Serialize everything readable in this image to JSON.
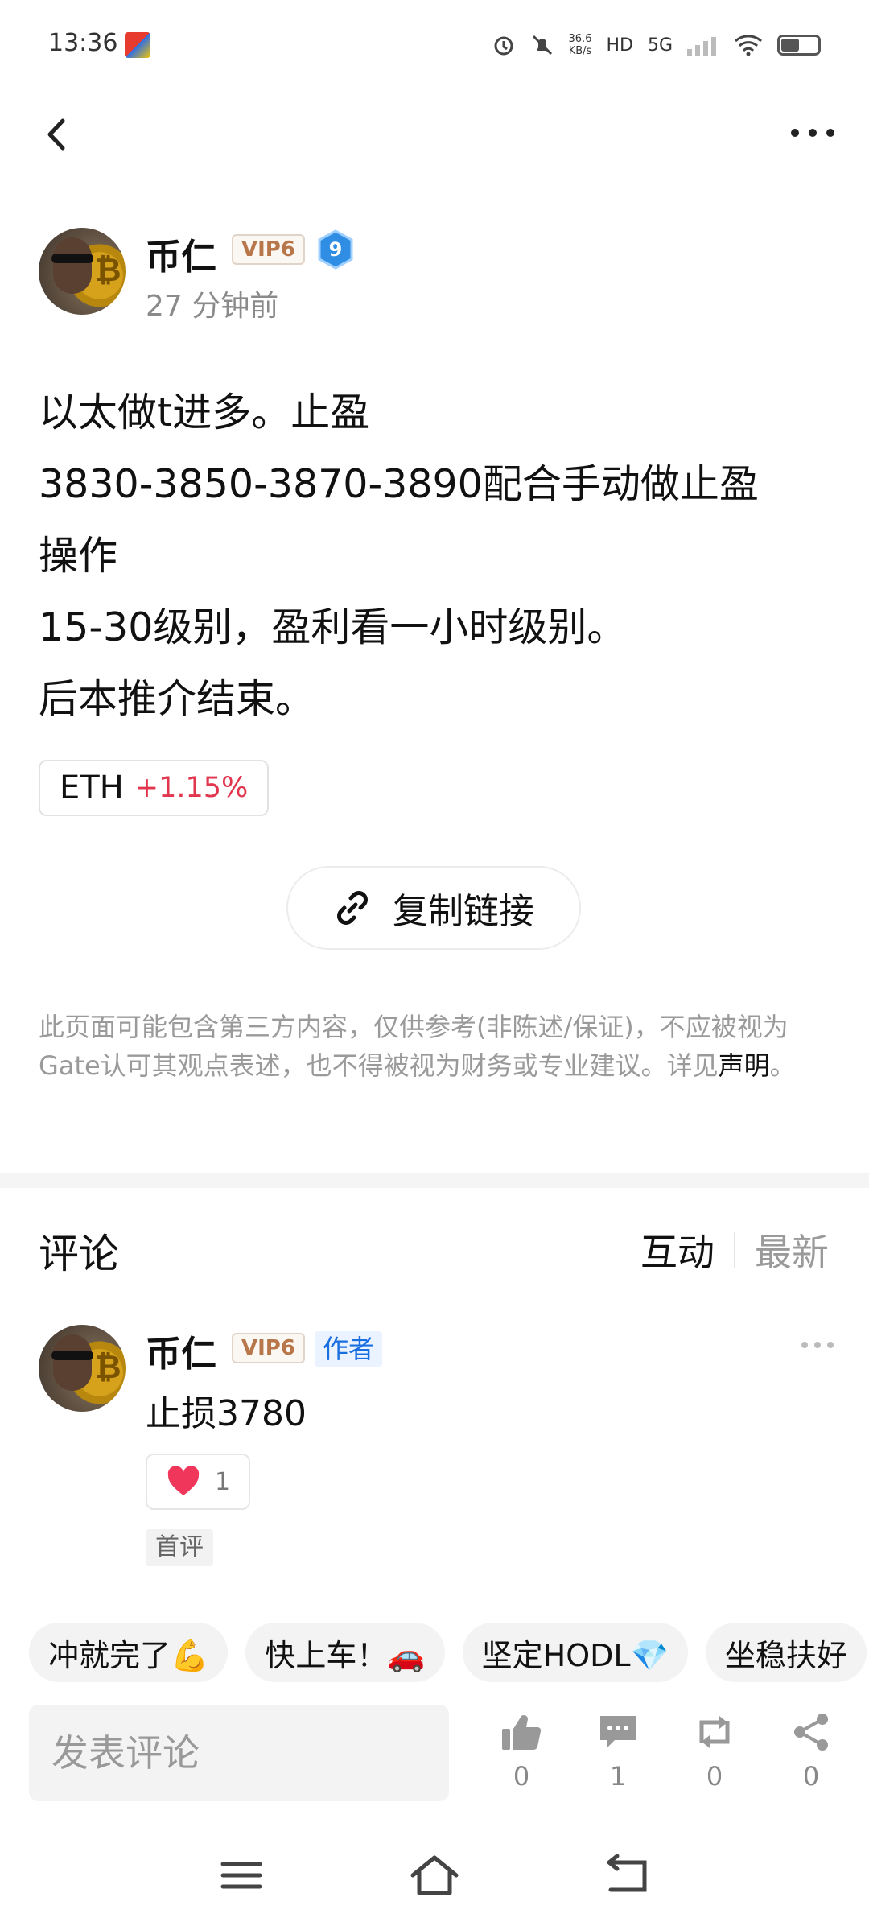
{
  "status_bar": {
    "time": "13:36",
    "net_speed_value": "36.6",
    "net_speed_unit": "KB/s",
    "hd_label": "HD",
    "network_label": "5G"
  },
  "post": {
    "author": {
      "name": "币仁",
      "vip": "VIP6",
      "level": "9",
      "time_ago": "27 分钟前"
    },
    "lines": [
      "以太做t进多。止盈",
      "3830-3850-3870-3890配合手动做止盈",
      "操作",
      "15-30级别，盈利看一小时级别。",
      "后本推介结束。"
    ],
    "tag": {
      "symbol": "ETH",
      "change": "+1.15%"
    },
    "copy_link_label": "复制链接",
    "disclaimer": "此页面可能包含第三方内容，仅供参考(非陈述/保证)，不应被视为Gate认可其观点表述，也不得被视为财务或专业建议。详见",
    "disclaimer_link": "声明",
    "disclaimer_end": "。"
  },
  "comments": {
    "title": "评论",
    "sort_interactive": "互动",
    "sort_latest": "最新",
    "items": [
      {
        "name": "币仁",
        "vip": "VIP6",
        "author_badge": "作者",
        "text": "止损3780",
        "likes": "1",
        "badge": "首评"
      }
    ]
  },
  "quick_replies": [
    "冲就完了💪",
    "快上车！🚗",
    "坚定HODL💎",
    "坐稳扶好"
  ],
  "bottom_bar": {
    "comment_placeholder": "发表评论",
    "like_count": "0",
    "comment_count": "1",
    "repost_count": "0",
    "share_count": "0"
  },
  "colors": {
    "positive_change": "#e2364f",
    "vip_text": "#b8774a",
    "author_badge": "#1a6fe0",
    "heart": "#f0365a",
    "level_badge": "#2f8de4"
  }
}
